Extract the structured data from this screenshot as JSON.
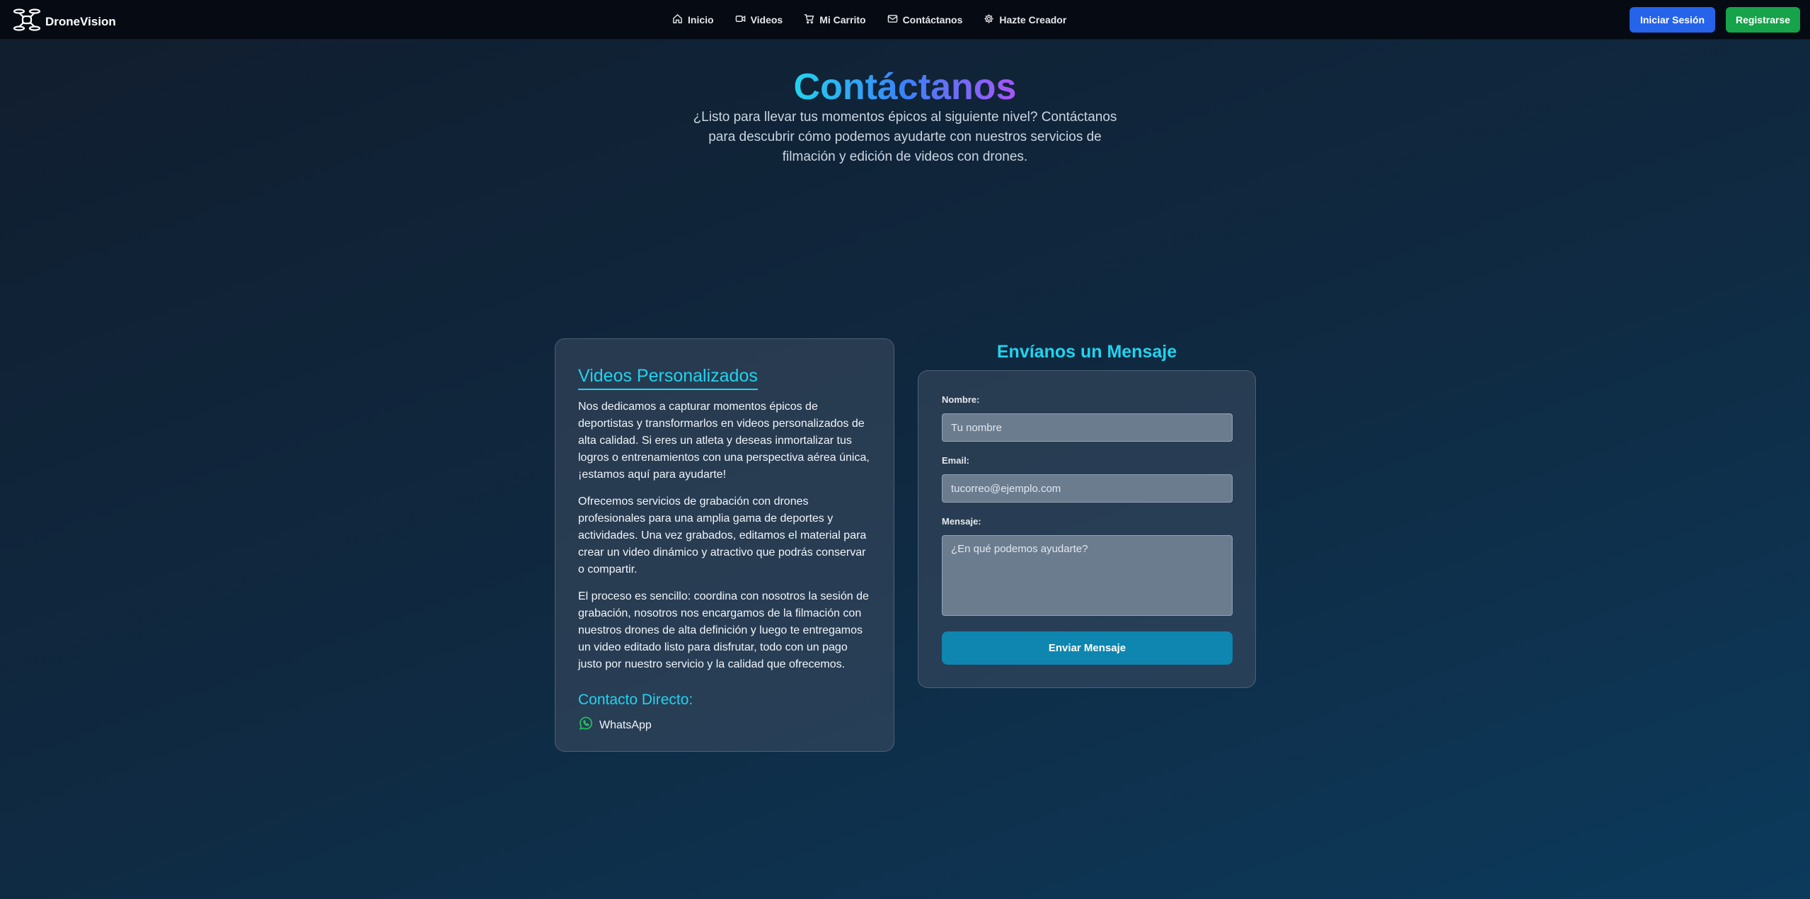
{
  "nav": {
    "brand": "DroneVision",
    "links": [
      {
        "label": "Inicio",
        "icon": "home-icon"
      },
      {
        "label": "Videos",
        "icon": "video-icon"
      },
      {
        "label": "Mi Carrito",
        "icon": "cart-icon"
      },
      {
        "label": "Contáctanos",
        "icon": "mail-icon"
      },
      {
        "label": "Hazte Creador",
        "icon": "gear-icon"
      }
    ],
    "login_label": "Iniciar Sesión",
    "register_label": "Registrarse",
    "colors": {
      "login": "#2563eb",
      "register": "#16a34a"
    }
  },
  "hero": {
    "title": "Contáctanos",
    "subtitle": "¿Listo para llevar tus momentos épicos al siguiente nivel? Contáctanos para descubrir cómo podemos ayudarte con nuestros servicios de filmación y edición de videos con drones."
  },
  "info_card": {
    "title": "Videos Personalizados",
    "paragraphs": [
      "Nos dedicamos a capturar momentos épicos de deportistas y transformarlos en videos personalizados de alta calidad. Si eres un atleta y deseas inmortalizar tus logros o entrenamientos con una perspectiva aérea única, ¡estamos aquí para ayudarte!",
      "Ofrecemos servicios de grabación con drones profesionales para una amplia gama de deportes y actividades. Una vez grabados, editamos el material para crear un video dinámico y atractivo que podrás conservar o compartir.",
      "El proceso es sencillo: coordina con nosotros la sesión de grabación, nosotros nos encargamos de la filmación con nuestros drones de alta definición y luego te entregamos un video editado listo para disfrutar, todo con un pago justo por nuestro servicio y la calidad que ofrecemos."
    ],
    "contact_heading": "Contacto Directo:",
    "whatsapp_label": "WhatsApp"
  },
  "form": {
    "title": "Envíanos un Mensaje",
    "name_label": "Nombre:",
    "name_placeholder": "Tu nombre",
    "email_label": "Email:",
    "email_placeholder": "tucorreo@ejemplo.com",
    "message_label": "Mensaje:",
    "message_placeholder": "¿En qué podemos ayudarte?",
    "submit_label": "Enviar Mensaje"
  },
  "theme": {
    "accent": "#22d3ee",
    "submit": "#0e86b0"
  }
}
